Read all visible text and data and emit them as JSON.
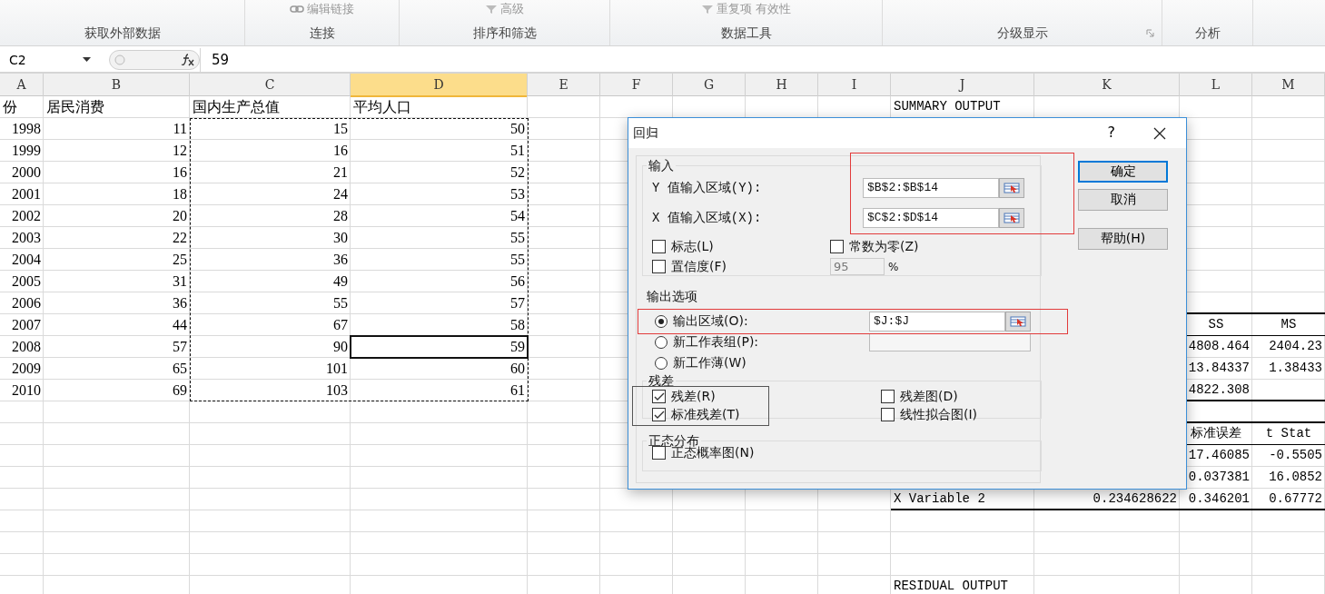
{
  "ribbon": {
    "groups": [
      {
        "label": "获取外部数据"
      },
      {
        "label": "连接",
        "items": [
          "编辑链接"
        ]
      },
      {
        "label": "排序和筛选",
        "items": [
          "高级"
        ]
      },
      {
        "label": "数据工具",
        "items": [
          "重复项 有效性"
        ]
      },
      {
        "label": "分级显示",
        "launcher": true
      },
      {
        "label": "分析"
      }
    ]
  },
  "formula_bar": {
    "name_box": "C2",
    "formula": "59"
  },
  "sheet": {
    "columns": [
      {
        "label": "A",
        "selected": false
      },
      {
        "label": "B",
        "selected": false
      },
      {
        "label": "C",
        "selected": false
      },
      {
        "label": "D",
        "selected": true
      },
      {
        "label": "E",
        "selected": false
      },
      {
        "label": "F",
        "selected": false
      },
      {
        "label": "G",
        "selected": false
      },
      {
        "label": "H",
        "selected": false
      },
      {
        "label": "I",
        "selected": false
      },
      {
        "label": "J",
        "selected": false
      },
      {
        "label": "K",
        "selected": false
      },
      {
        "label": "L",
        "selected": false
      },
      {
        "label": "M",
        "selected": false
      }
    ],
    "rows": [
      {
        "kind": "header",
        "cells": {
          "a": "份",
          "b": "居民消费",
          "c": "国内生产总值",
          "d": "平均人口",
          "j": "SUMMARY OUTPUT"
        }
      },
      {
        "kind": "data",
        "cells": {
          "a": "1998",
          "b": "11",
          "c": "15",
          "d": "50"
        }
      },
      {
        "kind": "data",
        "cells": {
          "a": "1999",
          "b": "12",
          "c": "16",
          "d": "51"
        }
      },
      {
        "kind": "data",
        "cells": {
          "a": "2000",
          "b": "16",
          "c": "21",
          "d": "52"
        }
      },
      {
        "kind": "data",
        "cells": {
          "a": "2001",
          "b": "18",
          "c": "24",
          "d": "53"
        }
      },
      {
        "kind": "data",
        "cells": {
          "a": "2002",
          "b": "20",
          "c": "28",
          "d": "54"
        }
      },
      {
        "kind": "data",
        "cells": {
          "a": "2003",
          "b": "22",
          "c": "30",
          "d": "55"
        }
      },
      {
        "kind": "data",
        "cells": {
          "a": "2004",
          "b": "25",
          "c": "36",
          "d": "55"
        }
      },
      {
        "kind": "data",
        "cells": {
          "a": "2005",
          "b": "31",
          "c": "49",
          "d": "56"
        }
      },
      {
        "kind": "data",
        "cells": {
          "a": "2006",
          "b": "36",
          "c": "55",
          "d": "57"
        },
        "thick_rule": true
      },
      {
        "kind": "data_caption",
        "cells": {
          "a": "2007",
          "b": "44",
          "c": "67",
          "d": "58",
          "l": "SS",
          "m": "MS"
        },
        "thin_rule": true
      },
      {
        "kind": "data",
        "active": true,
        "cells": {
          "a": "2008",
          "b": "57",
          "c": "90",
          "d": "59",
          "l": "4808.464",
          "m": "2404.23"
        }
      },
      {
        "kind": "data",
        "cells": {
          "a": "2009",
          "b": "65",
          "c": "101",
          "d": "60",
          "l": "13.84337",
          "m": "1.38433"
        }
      },
      {
        "kind": "data",
        "cells": {
          "a": "2010",
          "b": "69",
          "c": "103",
          "d": "61",
          "l": "4822.308"
        },
        "thick_rule": true
      },
      {
        "thick_rule": true
      },
      {
        "kind": "caption",
        "cells": {
          "l": "标准误差",
          "m": "t Stat"
        },
        "thin_rule": true
      },
      {
        "kind": "data",
        "cells": {
          "l": "17.46085",
          "m": "-0.5505"
        }
      },
      {
        "kind": "data",
        "cells": {
          "l": "0.037381",
          "m": "16.0852"
        }
      },
      {
        "kind": "labeled",
        "cells": {
          "j": "X Variable 2",
          "k": "0.234628622",
          "l": "0.346201",
          "m": "0.67772"
        },
        "thick_rule": true
      },
      {},
      {},
      {},
      {
        "kind": "title",
        "cells": {
          "j": "RESIDUAL OUTPUT"
        }
      }
    ]
  },
  "dialog": {
    "title": "回归",
    "help": "?",
    "input": {
      "label": "输入",
      "fields": [
        {
          "label": "Y 值输入区域(Y):",
          "value": "$B$2:$B$14"
        },
        {
          "label": "X 值输入区域(X):",
          "value": "$C$2:$D$14"
        }
      ],
      "checkboxes": [
        {
          "label": "标志(L)",
          "checked": false
        },
        {
          "label": "常数为零(Z)",
          "checked": false
        },
        {
          "label": "置信度(F)",
          "checked": false
        }
      ],
      "confidence": {
        "value": "95",
        "unit": "%",
        "disabled": true
      }
    },
    "output": {
      "label": "输出选项",
      "options": [
        {
          "label": "输出区域(O):",
          "selected": true,
          "value": "$J:$J",
          "kind": "picker"
        },
        {
          "label": "新工作表组(P):",
          "selected": false,
          "kind": "field"
        },
        {
          "label": "新工作薄(W)",
          "selected": false,
          "kind": "plain"
        }
      ]
    },
    "residuals": {
      "label": "残差",
      "checkboxes": [
        {
          "label": "残差(R)",
          "checked": true
        },
        {
          "label": "残差图(D)",
          "checked": false
        },
        {
          "label": "标准残差(T)",
          "checked": true
        },
        {
          "label": "线性拟合图(I)",
          "checked": false
        }
      ]
    },
    "normal": {
      "label": "正态分布",
      "checkboxes": [
        {
          "label": "正态概率图(N)",
          "checked": false
        }
      ]
    },
    "buttons": [
      {
        "label": "确定",
        "default": true
      },
      {
        "label": "取消",
        "default": false
      },
      {
        "label": "帮助(H)",
        "default": false
      }
    ]
  }
}
